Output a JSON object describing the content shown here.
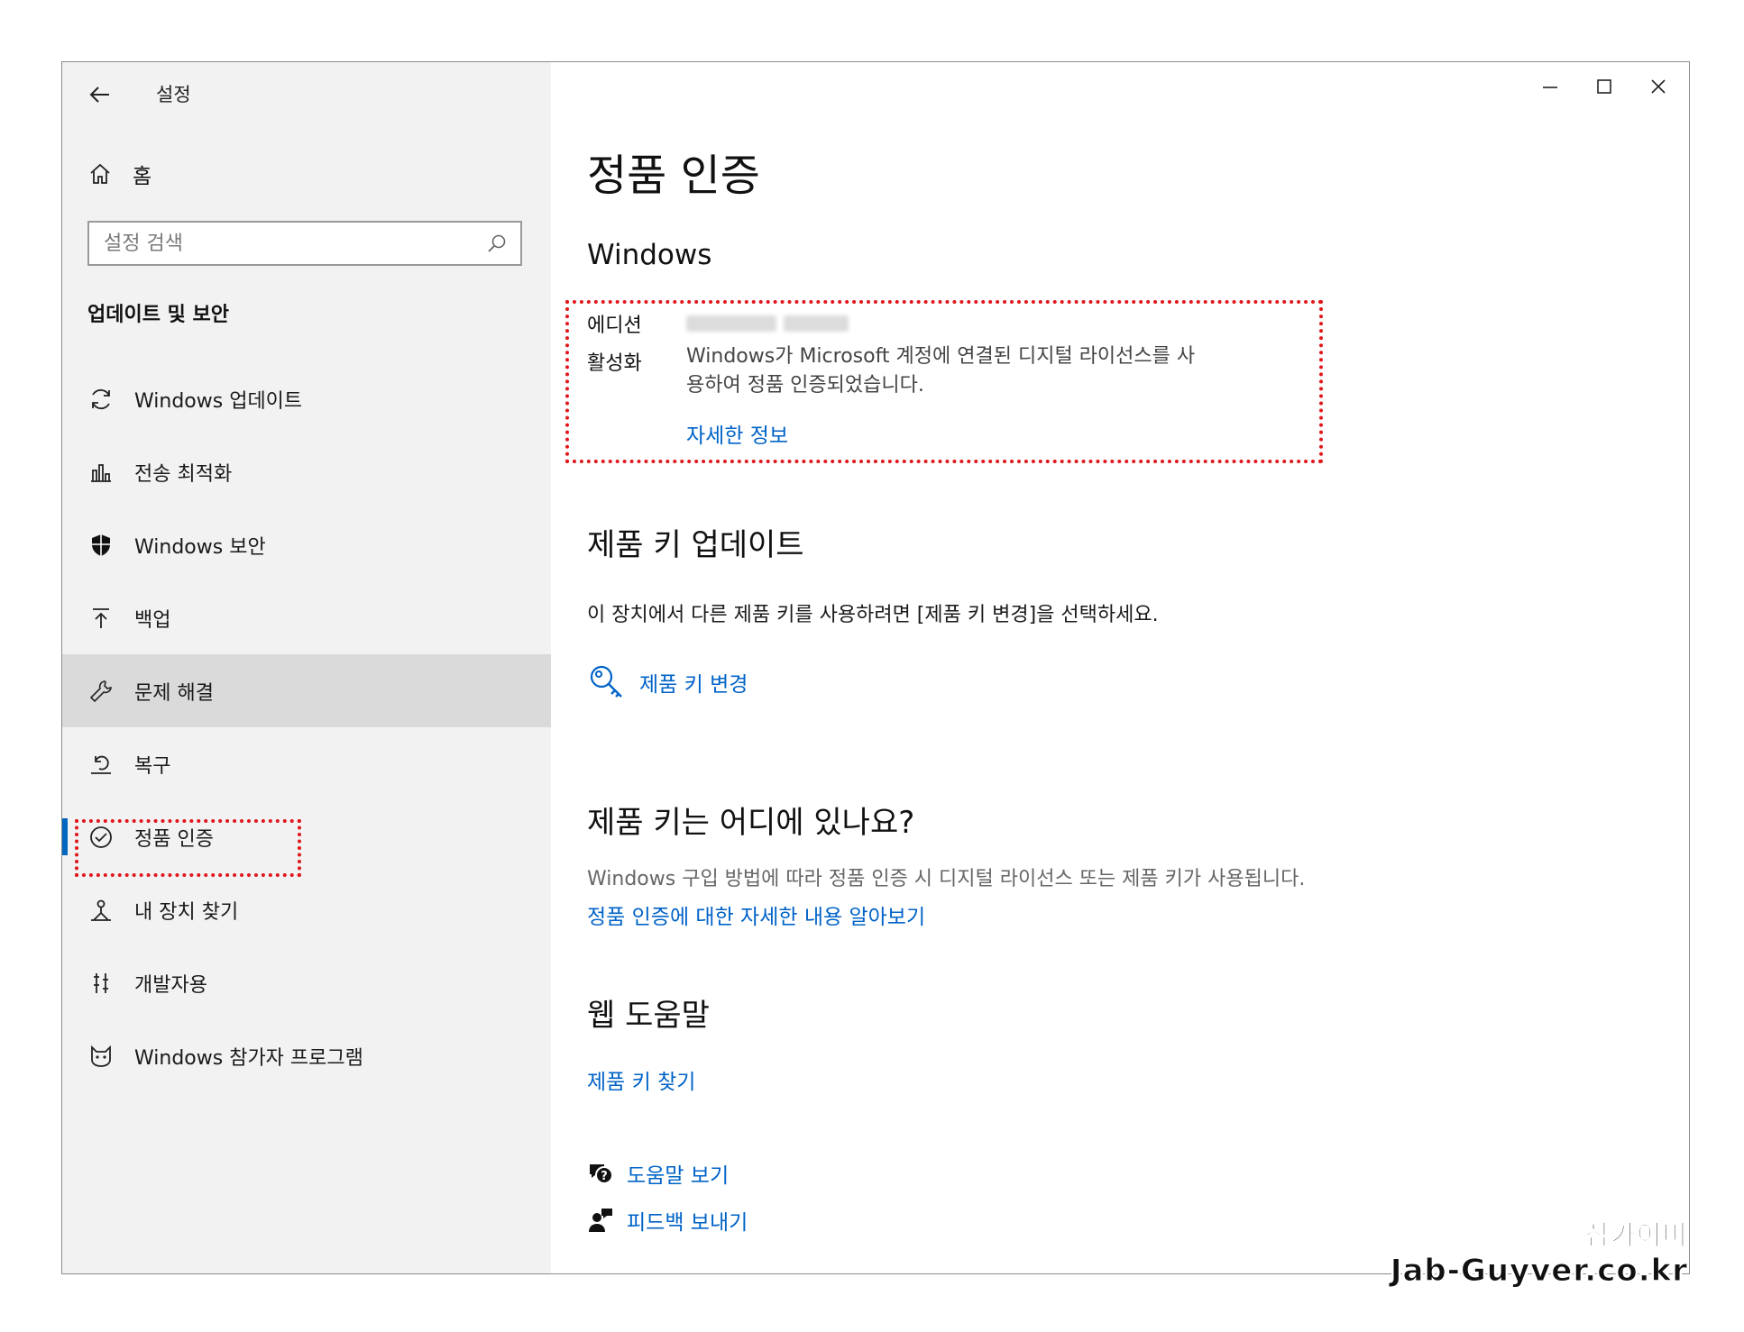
{
  "window": {
    "title": "설정",
    "controls": {
      "minimize": "minimize-icon",
      "maximize": "maximize-icon",
      "close": "close-icon"
    }
  },
  "sidebar": {
    "home_label": "홈",
    "search_placeholder": "설정 검색",
    "section_title": "업데이트 및 보안",
    "items": [
      {
        "label": "Windows 업데이트",
        "icon": "refresh-icon"
      },
      {
        "label": "전송 최적화",
        "icon": "delivery-optimization-icon"
      },
      {
        "label": "Windows 보안",
        "icon": "shield-icon"
      },
      {
        "label": "백업",
        "icon": "upload-arrow-icon"
      },
      {
        "label": "문제 해결",
        "icon": "wrench-icon"
      },
      {
        "label": "복구",
        "icon": "recovery-icon"
      },
      {
        "label": "정품 인증",
        "icon": "check-circle-icon"
      },
      {
        "label": "내 장치 찾기",
        "icon": "find-device-icon"
      },
      {
        "label": "개발자용",
        "icon": "developer-tools-icon"
      },
      {
        "label": "Windows 참가자 프로그램",
        "icon": "insider-cat-icon"
      }
    ],
    "hover_index": 4,
    "active_index": 6
  },
  "main": {
    "title": "정품 인증",
    "windows_heading": "Windows",
    "edition_label": "에디션",
    "activation_label": "활성화",
    "activation_text_line1": "Windows가 Microsoft 계정에 연결된 디지털 라이선스를 사",
    "activation_text_line2": "용하여 정품 인증되었습니다.",
    "more_info_link": "자세한 정보",
    "product_key_update_heading": "제품 키 업데이트",
    "product_key_update_text": "이 장치에서 다른 제품 키를 사용하려면 [제품 키 변경]을 선택하세요.",
    "change_key_link": "제품 키 변경",
    "where_key_heading": "제품 키는 어디에 있나요?",
    "where_key_text": "Windows 구입 방법에 따라 정품 인증 시 디지털 라이선스 또는 제품 키가 사용됩니다.",
    "learn_more_link": "정품 인증에 대한 자세한 내용 알아보기",
    "web_help_heading": "웹 도움말",
    "find_key_link": "제품 키 찾기",
    "help_link": "도움말 보기",
    "feedback_link": "피드백 보내기"
  },
  "watermark": {
    "line1": "잡가이버",
    "line2": "Jab-Guyver.co.kr"
  },
  "colors": {
    "accent": "#0063c7",
    "highlight_border": "#e0161b",
    "sidebar_bg": "#f2f2f2",
    "sidebar_hover": "#dadada",
    "active_indicator": "#0067c0"
  }
}
